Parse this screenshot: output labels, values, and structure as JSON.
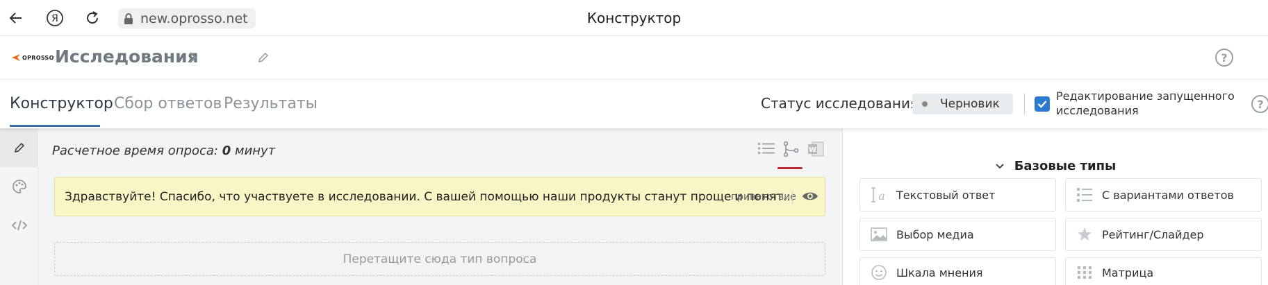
{
  "browser": {
    "url": "new.oprosso.net",
    "title": "Конструктор"
  },
  "app": {
    "logo_text": "OPROSSO",
    "breadcrumb": "Исследования"
  },
  "tabs": [
    {
      "label": "Конструктор",
      "active": true
    },
    {
      "label": "Сбор ответов",
      "active": false
    },
    {
      "label": "Результаты",
      "active": false
    }
  ],
  "status": {
    "label": "Статус исследования:",
    "value": "Черновик",
    "edit_running_label": "Редактирование запущенного исследования",
    "edit_running_checked": true
  },
  "left_rail": [
    "pencil-icon",
    "palette-icon",
    "code-icon"
  ],
  "canvas": {
    "est_time_prefix": "Расчетное время опроса:",
    "est_time_value": "0",
    "est_time_unit": "минут",
    "view_modes": [
      "list-icon",
      "branch-icon",
      "word-icon"
    ],
    "active_view": "branch-icon",
    "welcome_text": "Здравствуйте! Спасибо, что участвуете в исследовании. С вашей помощью наши продукты станут проще и понят...",
    "welcome_tag": "приветствие",
    "dropzone_text": "Перетащите сюда тип вопроса"
  },
  "panel": {
    "section_title": "Базовые типы",
    "question_types": [
      {
        "label": "Текстовый ответ",
        "icon": "text-icon"
      },
      {
        "label": "С вариантами ответов",
        "icon": "options-icon"
      },
      {
        "label": "Выбор медиа",
        "icon": "image-icon"
      },
      {
        "label": "Рейтинг/Слайдер",
        "icon": "star-icon"
      },
      {
        "label": "Шкала мнения",
        "icon": "smiley-icon"
      },
      {
        "label": "Матрица",
        "icon": "grid-icon"
      }
    ]
  },
  "colors": {
    "accent_blue": "#2b7bd0",
    "tab_underline": "#3a6fa6",
    "welcome_bg": "#f8f6c5",
    "active_view_marker": "#c0262b"
  }
}
